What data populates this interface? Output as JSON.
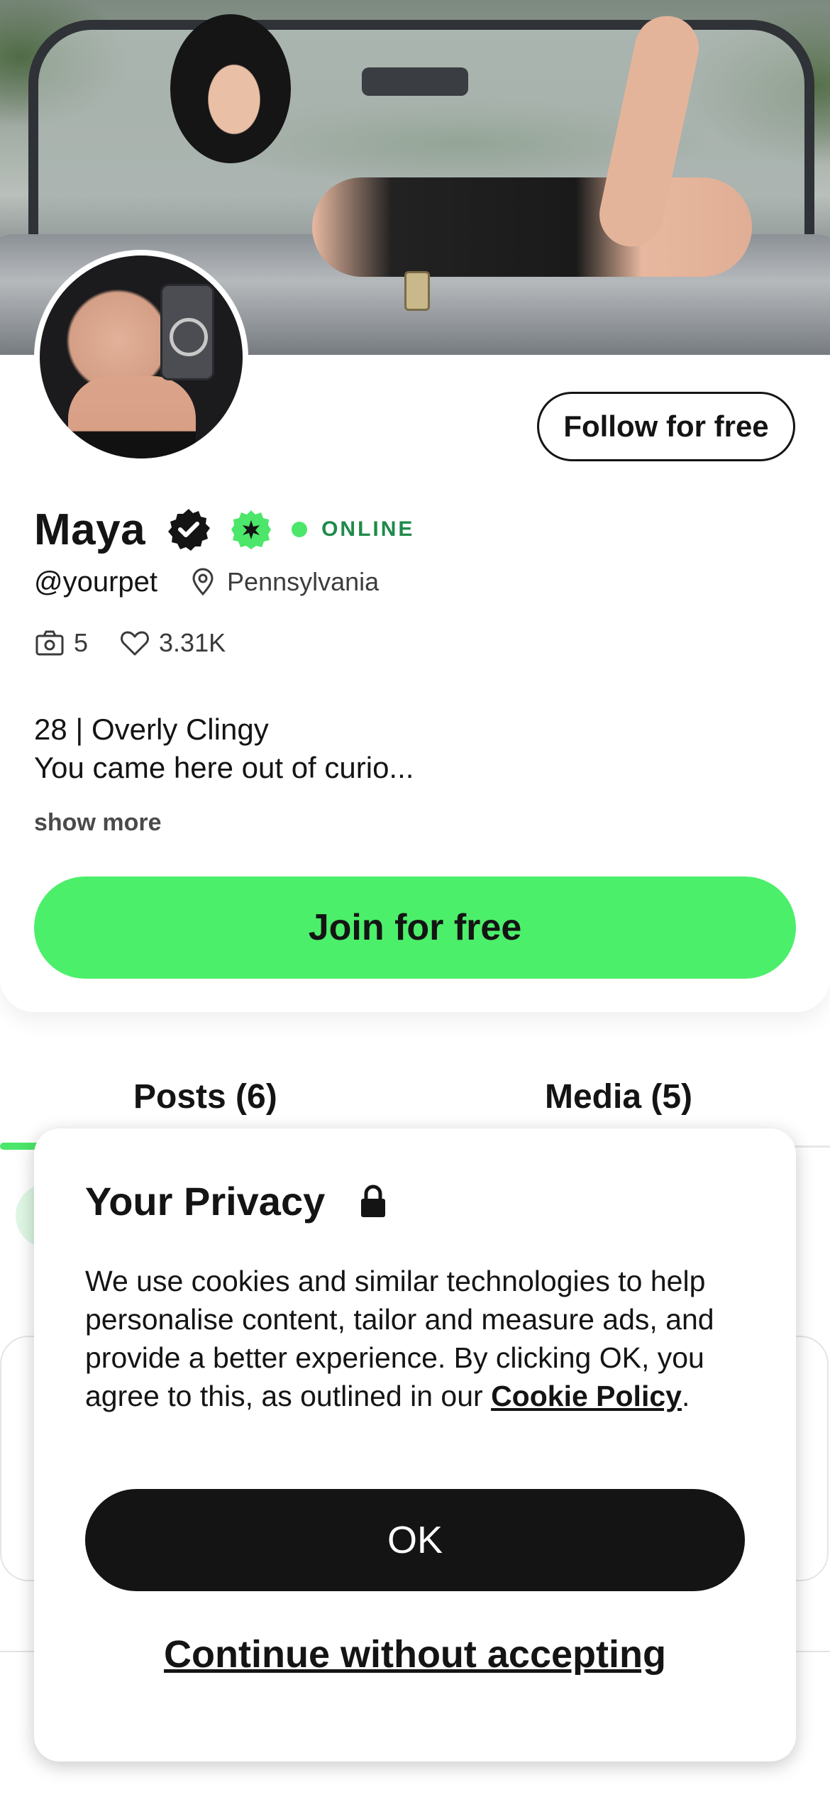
{
  "profile": {
    "follow_label": "Follow for free",
    "name": "Maya",
    "status": "ONLINE",
    "handle": "@yourpet",
    "location": "Pennsylvania",
    "media_count": "5",
    "likes_count": "3.31K",
    "bio_line1": "28 | Overly Clingy",
    "bio_line2": "You came here out of curio...",
    "show_more_label": "show more",
    "join_label": "Join for free"
  },
  "tabs": [
    {
      "label": "Posts (6)",
      "active": true
    },
    {
      "label": "Media (5)",
      "active": false
    }
  ],
  "privacy": {
    "title": "Your Privacy",
    "body_prefix": "We use cookies and similar technologies to help personalise content, tailor and measure ads, and provide a better experience. By clicking OK, you agree to this, as outlined in our ",
    "cookie_policy_label": "Cookie Policy",
    "body_suffix": ".",
    "ok_label": "OK",
    "continue_label": "Continue without accepting"
  },
  "colors": {
    "accent_green": "#4cef6a",
    "online_text": "#1f8a4b",
    "ink": "#141414"
  },
  "icons": {
    "verified": "verified-badge-icon",
    "green_badge": "green-star-badge-icon",
    "location": "map-pin-icon",
    "media": "camera-icon",
    "likes": "heart-icon",
    "lock": "lock-icon"
  }
}
